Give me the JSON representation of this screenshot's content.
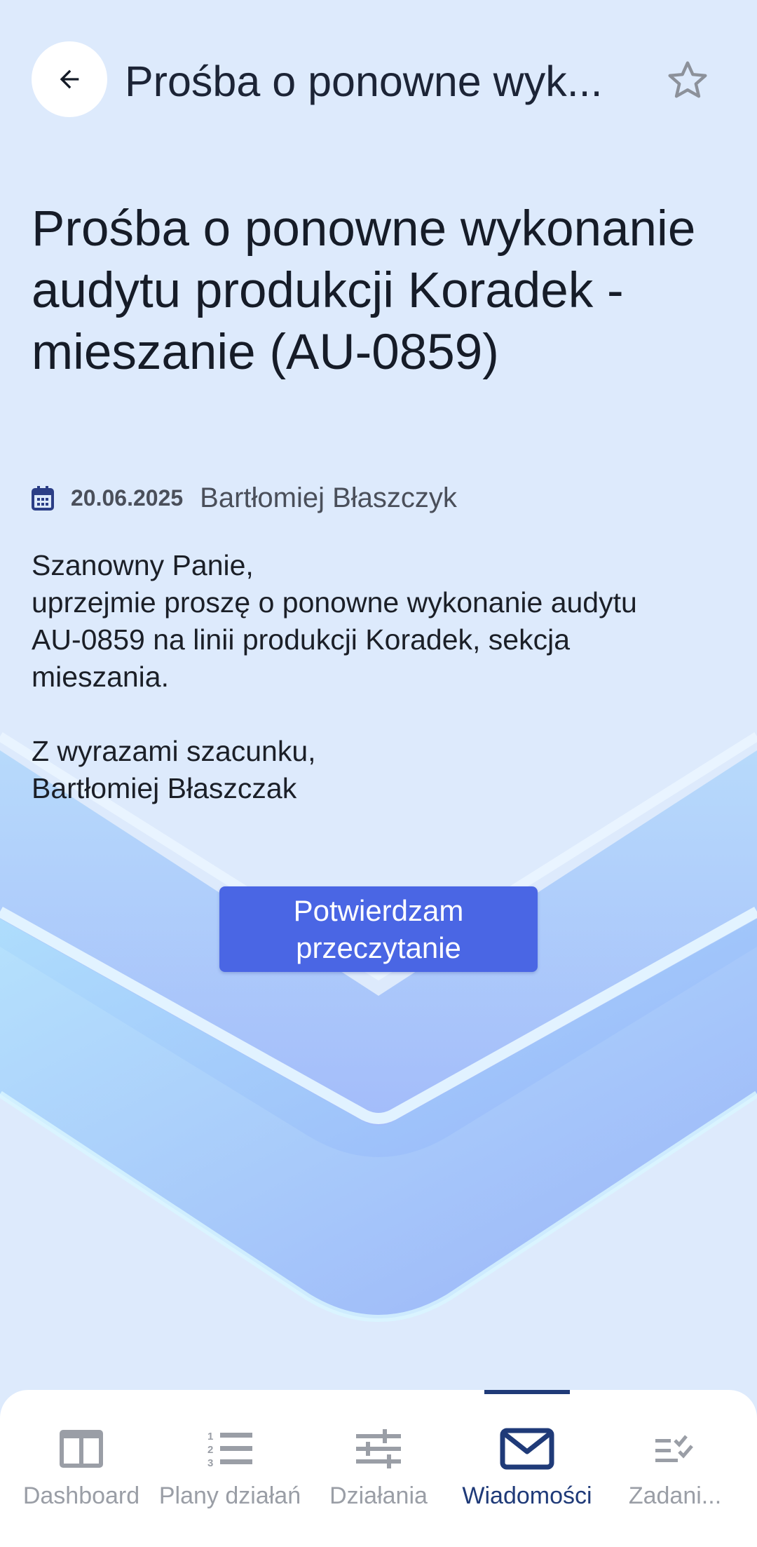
{
  "header": {
    "title": "Prośba o ponowne wyk..."
  },
  "message": {
    "title": "Prośba o ponowne wykonanie audytu produkcji Koradek - mieszanie (AU-0859)",
    "date": "20.06.2025",
    "author": "Bartłomiej Błaszczyk",
    "body": {
      "greeting": "Szanowny Panie,",
      "line1": "uprzejmie proszę o ponowne wykonanie audytu",
      "line2": "AU-0859 na linii produkcji Koradek, sekcja",
      "line3": "mieszania.",
      "closing": "Z wyrazami szacunku,",
      "signature": "Bartłomiej Błaszczak"
    },
    "confirm_label": "Potwierdzam przeczytanie"
  },
  "nav": {
    "items": [
      {
        "label": "Dashboard",
        "icon": "dashboard-icon",
        "active": false
      },
      {
        "label": "Plany działań",
        "icon": "numbered-list-icon",
        "active": false
      },
      {
        "label": "Działania",
        "icon": "sliders-icon",
        "active": false
      },
      {
        "label": "Wiadomości",
        "icon": "mail-icon",
        "active": true
      },
      {
        "label": "Zadani...",
        "icon": "checklist-icon",
        "active": false
      }
    ]
  },
  "colors": {
    "accent": "#4a66e4",
    "nav_active": "#1f3a78",
    "nav_inactive": "#9a9ea6",
    "background": "#ddeafc"
  }
}
